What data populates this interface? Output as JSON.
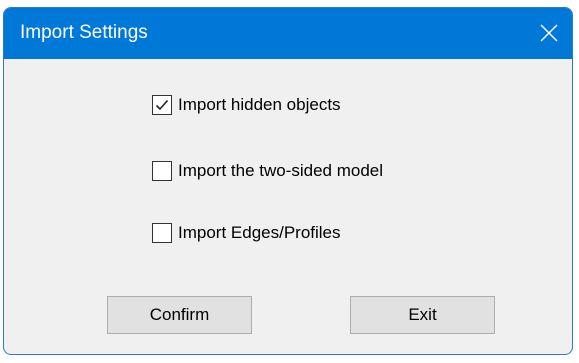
{
  "window": {
    "title": "Import Settings",
    "close_icon": "close-icon",
    "titlebar_color": "#0078d7"
  },
  "options": [
    {
      "label": "Import hidden objects",
      "checked": true
    },
    {
      "label": "Import the two-sided model",
      "checked": false
    },
    {
      "label": "Import Edges/Profiles",
      "checked": false
    }
  ],
  "buttons": {
    "confirm_label": "Confirm",
    "exit_label": "Exit"
  }
}
